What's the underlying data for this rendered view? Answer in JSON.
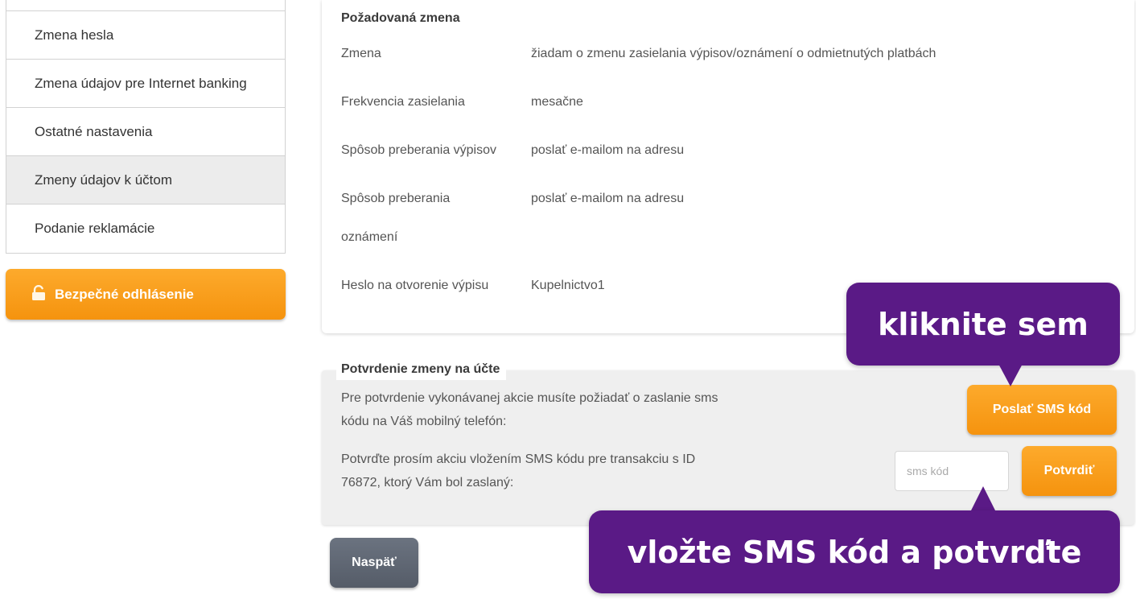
{
  "sidebar": {
    "items": [
      {
        "label": "Zmena hesla"
      },
      {
        "label": "Zmena údajov pre Internet banking"
      },
      {
        "label": "Ostatné nastavenia"
      },
      {
        "label": "Zmeny údajov k účtom",
        "active": true
      },
      {
        "label": "Podanie reklamácie"
      }
    ],
    "logout_label": "Bezpečné odhlásenie"
  },
  "requested_change": {
    "title": "Požadovaná zmena",
    "fields": [
      {
        "label": "Zmena",
        "value": "žiadam o zmenu zasielania výpisov/oznámení o odmietnutých platbách"
      },
      {
        "label": "Frekvencia zasielania",
        "value": "mesačne"
      },
      {
        "label": "Spôsob preberania výpisov",
        "value": "poslať e-mailom na adresu"
      },
      {
        "label_line1": "Spôsob preberania",
        "label_line2": "oznámení",
        "value": "poslať e-mailom na adresu"
      },
      {
        "label": "Heslo na otvorenie výpisu",
        "value": "Kupelnictvo1"
      }
    ]
  },
  "confirmation": {
    "title": "Potvrdenie zmeny na účte",
    "request_text_line1": "Pre potvrdenie vykonávanej akcie musíte požiadať o zaslanie sms",
    "request_text_line2": "kódu na Váš mobilný telefón:",
    "send_sms_label": "Poslať SMS kód",
    "confirm_text_line1": "Potvrďte prosím akciu vložením SMS kódu pre transakciu s ID",
    "confirm_text_line2": "76872, ktorý Vám bol zaslaný:",
    "sms_placeholder": "sms kód",
    "sms_value": "",
    "confirm_label": "Potvrdiť"
  },
  "back_label": "Naspäť",
  "callouts": {
    "top": "kliknite sem",
    "bottom": "vložte SMS kód a potvrďte"
  },
  "colors": {
    "accent_orange": "#f7a01c",
    "callout_purple": "#5a1a86",
    "back_gray": "#5f6672"
  },
  "icons": {
    "logout": "lock-icon"
  }
}
